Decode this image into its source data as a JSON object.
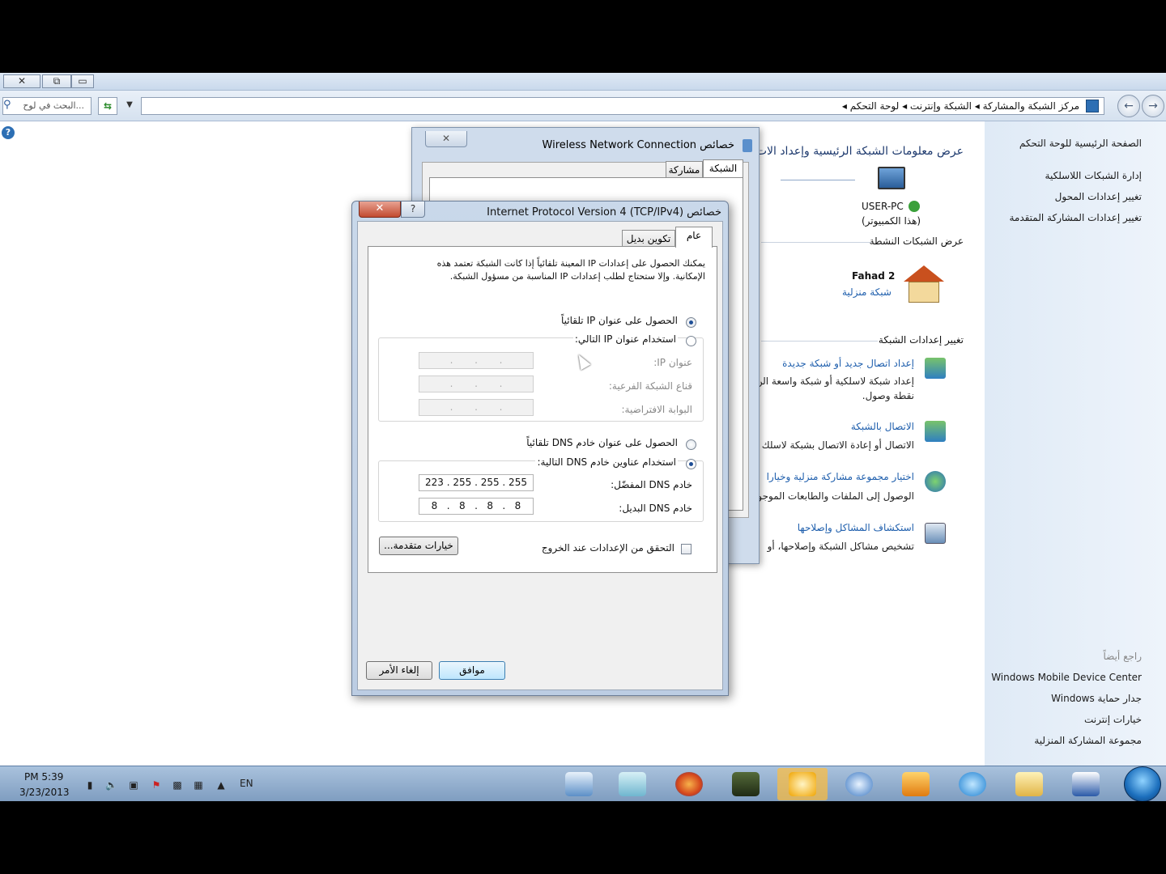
{
  "window": {
    "minimize_glyph": "▭",
    "maximize_glyph": "⧉",
    "close_glyph": "✕"
  },
  "address_bar": {
    "search_placeholder": "البحث في لوح...",
    "breadcrumb": "مركز الشبكة والمشاركة  ◂  الشبكة وإنترنت  ◂  لوحة التحكم  ◂"
  },
  "sidebar": {
    "items": [
      {
        "label": "الصفحة الرئيسية للوحة التحكم"
      },
      {
        "label": "إدارة الشبكات اللاسلكية"
      },
      {
        "label": "تغيير إعدادات المحول"
      },
      {
        "label": "تغيير إعدادات المشاركة المتقدمة"
      }
    ],
    "see_also_title": "راجع أيضاً",
    "see_also": [
      {
        "label": "Windows Mobile Device Center"
      },
      {
        "label": "جدار حماية Windows"
      },
      {
        "label": "خيارات إنترنت"
      },
      {
        "label": "مجموعة المشاركة المنزلية"
      }
    ]
  },
  "main": {
    "heading": "عرض معلومات الشبكة الرئيسية وإعداد الات",
    "computer_name": "USER-PC",
    "computer_sub": "(هذا الكمبيوتر)",
    "active_networks_title": "عرض الشبكات النشطة",
    "network_name": "Fahad 2",
    "network_type": "شبكة منزلية",
    "change_settings_title": "تغيير إعدادات الشبكة",
    "tasks": [
      {
        "title": "إعداد اتصال جديد أو شبكة جديدة",
        "desc1": "إعداد شبكة لاسلكية أو شبكة واسعة الن",
        "desc2": "نقطة وصول."
      },
      {
        "title": "الاتصال بالشبكة",
        "desc1": "الاتصال أو إعادة الاتصال بشبكة لاسلك",
        "desc2": ""
      },
      {
        "title": "اختيار مجموعة مشاركة منزلية وخيارا",
        "desc1": "الوصول إلى الملفات والطابعات الموجود",
        "desc2": ""
      },
      {
        "title": "استكشاف المشاكل وإصلاحها",
        "desc1": "تشخيص مشاكل الشبكة وإصلاحها، أو",
        "desc2": ""
      }
    ]
  },
  "wireless_dialog": {
    "title": "خصائص Wireless Network Connection",
    "close_glyph": "✕",
    "tabs": [
      "الشبكة",
      "مشاركة"
    ]
  },
  "tcp_dialog": {
    "title": "خصائص Internet Protocol Version 4 (TCP/IPv4)",
    "close_glyph": "✕",
    "help_glyph": "?",
    "tabs": [
      "عام",
      "تكوين بديل"
    ],
    "intro_line1": "يمكنك الحصول على إعدادات IP المعينة تلقائياً إذا كانت الشبكة تعتمد هذه",
    "intro_line2": "الإمكانية. وإلا ستحتاج لطلب إعدادات IP المناسبة من مسؤول الشبكة.",
    "ip_auto_label": "الحصول على عنوان IP تلقائياً",
    "ip_manual_label": "استخدام عنوان IP التالي:",
    "ip_address_label": "عنوان IP:",
    "subnet_label": "قناع الشبكة الفرعية:",
    "gateway_label": "البوابة الافتراضية:",
    "empty_ip": ".       .       .",
    "dns_auto_label": "الحصول على عنوان خادم DNS تلقائياً",
    "dns_manual_label": "استخدام عناوين خادم DNS التالية:",
    "preferred_dns_label": "خادم DNS المفضّل:",
    "preferred_dns_value": "223 . 255 . 255 . 255",
    "alternate_dns_label": "خادم DNS البديل:",
    "alternate_dns_value": "8   .   8   .   8   .   8",
    "validate_label": "التحقق من الإعدادات عند الخروج",
    "advanced_button": "خيارات متقدمة...",
    "ok_button": "موافق",
    "cancel_button": "إلغاء الأمر"
  },
  "taskbar": {
    "time": "PM 5:39",
    "date": "3/23/2013",
    "language": "EN",
    "apps": [
      "control-panel",
      "notepad",
      "firefox",
      "camtasia",
      "atom-app",
      "safari",
      "media-player",
      "internet-explorer",
      "file-explorer",
      "word"
    ]
  }
}
